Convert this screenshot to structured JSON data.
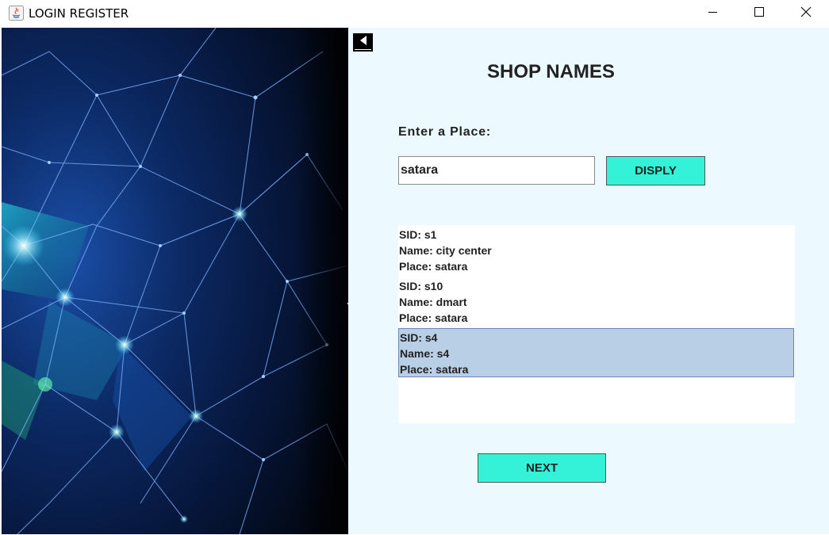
{
  "window": {
    "title": "LOGIN REGISTER",
    "controls": [
      "minimize-icon",
      "maximize-icon",
      "close-icon"
    ]
  },
  "page": {
    "title": "SHOP NAMES",
    "back_icon": "back-arrow-icon",
    "place_label": "Enter a Place:",
    "place_value": "satara",
    "display_button": "DISPLY",
    "next_button": "NEXT"
  },
  "results": [
    {
      "sid": "SID: s1",
      "name": "Name: city center",
      "place": "Place: satara",
      "selected": false
    },
    {
      "sid": "SID: s10",
      "name": "Name: dmart",
      "place": "Place: satara",
      "selected": false
    },
    {
      "sid": "SID: s4",
      "name": "Name: s4",
      "place": "Place: satara",
      "selected": true
    }
  ],
  "colors": {
    "accent_button": "#33f2d8",
    "panel_background": "#ecfaff",
    "selection": "#b8cfe5"
  }
}
